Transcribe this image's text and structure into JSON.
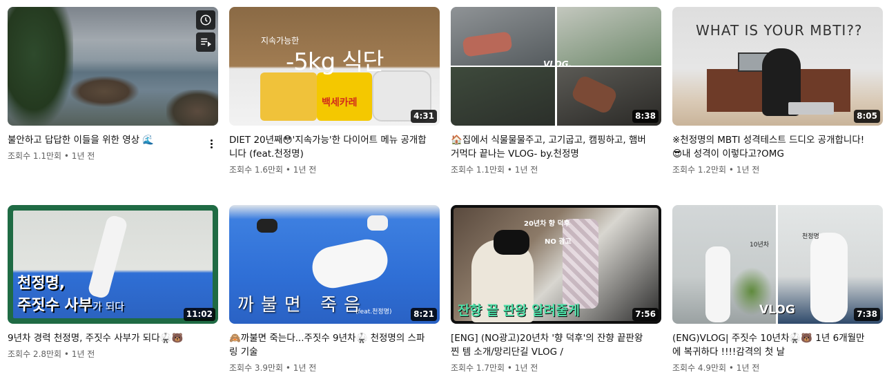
{
  "videos": [
    {
      "title": "불안하고 답답한 이들을 위한 영상 🌊",
      "meta": "조회수 1.1만회 • 1년 전",
      "duration": "",
      "hover_icons": [
        "clock-icon",
        "add-to-queue-icon"
      ]
    },
    {
      "title": "DIET 20년째😳'지속가능'한 다이어트 메뉴 공개합니다 (feat.천정명)",
      "meta": "조회수 1.6만회 • 1년 전",
      "duration": "4:31",
      "overlay_main": "-5kg 식단",
      "overlay_small": "지속가능한",
      "overlay_label": "백세카레"
    },
    {
      "title": "🏠집에서 식물물물주고, 고기굽고, 캠핑하고, 햄버거먹다 끝나는 VLOG- by.천정명",
      "meta": "조회수 1.1만회 • 1년 전",
      "duration": "8:38",
      "overlay_small": "VLOG."
    },
    {
      "title": "※천정명의 MBTI 성격테스트 드디오 공개합니다!😎내 성격이 이렇다고?OMG",
      "meta": "조회수 1.2만회 • 1년 전",
      "duration": "8:05",
      "overlay_main": "WHAT IS YOUR MBTI??"
    },
    {
      "title": "9년차 경력 천정명, 주짓수 사부가 되다🥋🐻",
      "meta": "조회수 2.8만회 • 1년 전",
      "duration": "11:02",
      "overlay_line1": "천정명,",
      "overlay_line2": "주짓수 사부",
      "overlay_line2_suffix": "가 되다"
    },
    {
      "title": "🙈까불면 죽는다...주짓수 9년차🥋 천정명의 스파링 기술",
      "meta": "조회수 3.9만회 • 1년 전",
      "duration": "8:21",
      "overlay_main": "까불면 죽음",
      "overlay_small": "(feat.천정명)"
    },
    {
      "title": "[ENG] (NO광고)20년차 '향 덕후'의 잔향 끝판왕 찐 템 소개/망리단길 VLOG /",
      "meta": "조회수 1.7만회 • 1년 전",
      "duration": "7:56",
      "overlay_main": "잔향 끝 판왕 알려줄게",
      "overlay_small": "20년차 향 덕후",
      "overlay_small2": "NO 광고"
    },
    {
      "title": "(ENG)VLOG| 주짓수 10년차🥋🐻 1년 6개월만에 복귀하다 !!!!감격의 첫 날",
      "meta": "조회수 4.9만회 • 1년 전",
      "duration": "7:38",
      "overlay_main": "VLOG",
      "overlay_small": "천정명",
      "overlay_small2": "10년차"
    }
  ],
  "colors": {
    "meta_text": "#606060",
    "title_text": "#0f0f0f",
    "duration_bg": "#000000",
    "mat_blue": "#2f6fd6",
    "frame_green": "#1f6b44"
  },
  "more_icon": "more-vert-icon"
}
